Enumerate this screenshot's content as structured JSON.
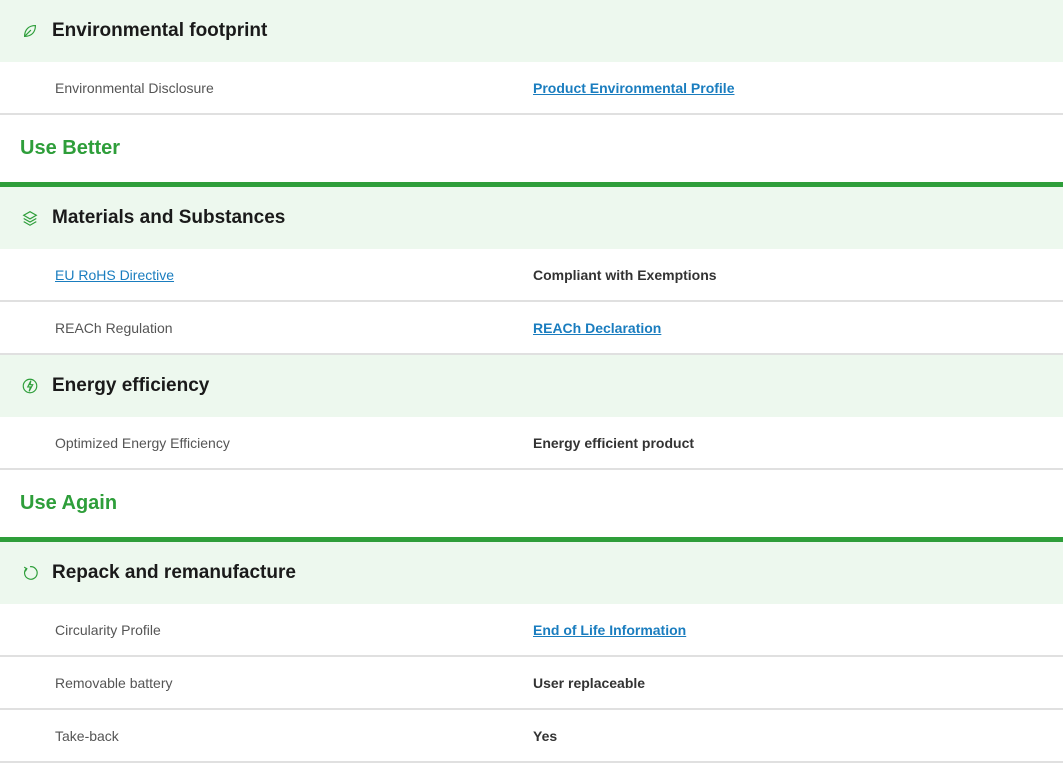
{
  "colors": {
    "accent_green": "#2e9e3a",
    "header_bg": "#edf8ee",
    "link_blue": "#1a7dbf"
  },
  "env_footprint": {
    "title": "Environmental footprint",
    "icon": "leaf-icon",
    "rows": [
      {
        "label": "Environmental Disclosure",
        "value": "Product Environmental Profile"
      }
    ]
  },
  "use_better": {
    "heading": "Use Better",
    "materials": {
      "title": "Materials and Substances",
      "icon": "layers-icon",
      "rows": [
        {
          "label": "EU RoHS Directive",
          "value": "Compliant with Exemptions"
        },
        {
          "label": "REACh Regulation",
          "value": "REACh Declaration"
        }
      ]
    },
    "energy": {
      "title": "Energy efficiency",
      "icon": "energy-leaf-icon",
      "rows": [
        {
          "label": "Optimized Energy Efficiency",
          "value": "Energy efficient product"
        }
      ]
    }
  },
  "use_again": {
    "heading": "Use Again",
    "repack": {
      "title": "Repack and remanufacture",
      "icon": "refresh-icon",
      "rows": [
        {
          "label": "Circularity Profile",
          "value": "End of Life Information"
        },
        {
          "label": "Removable battery",
          "value": "User replaceable"
        },
        {
          "label": "Take-back",
          "value": "Yes"
        }
      ]
    }
  }
}
